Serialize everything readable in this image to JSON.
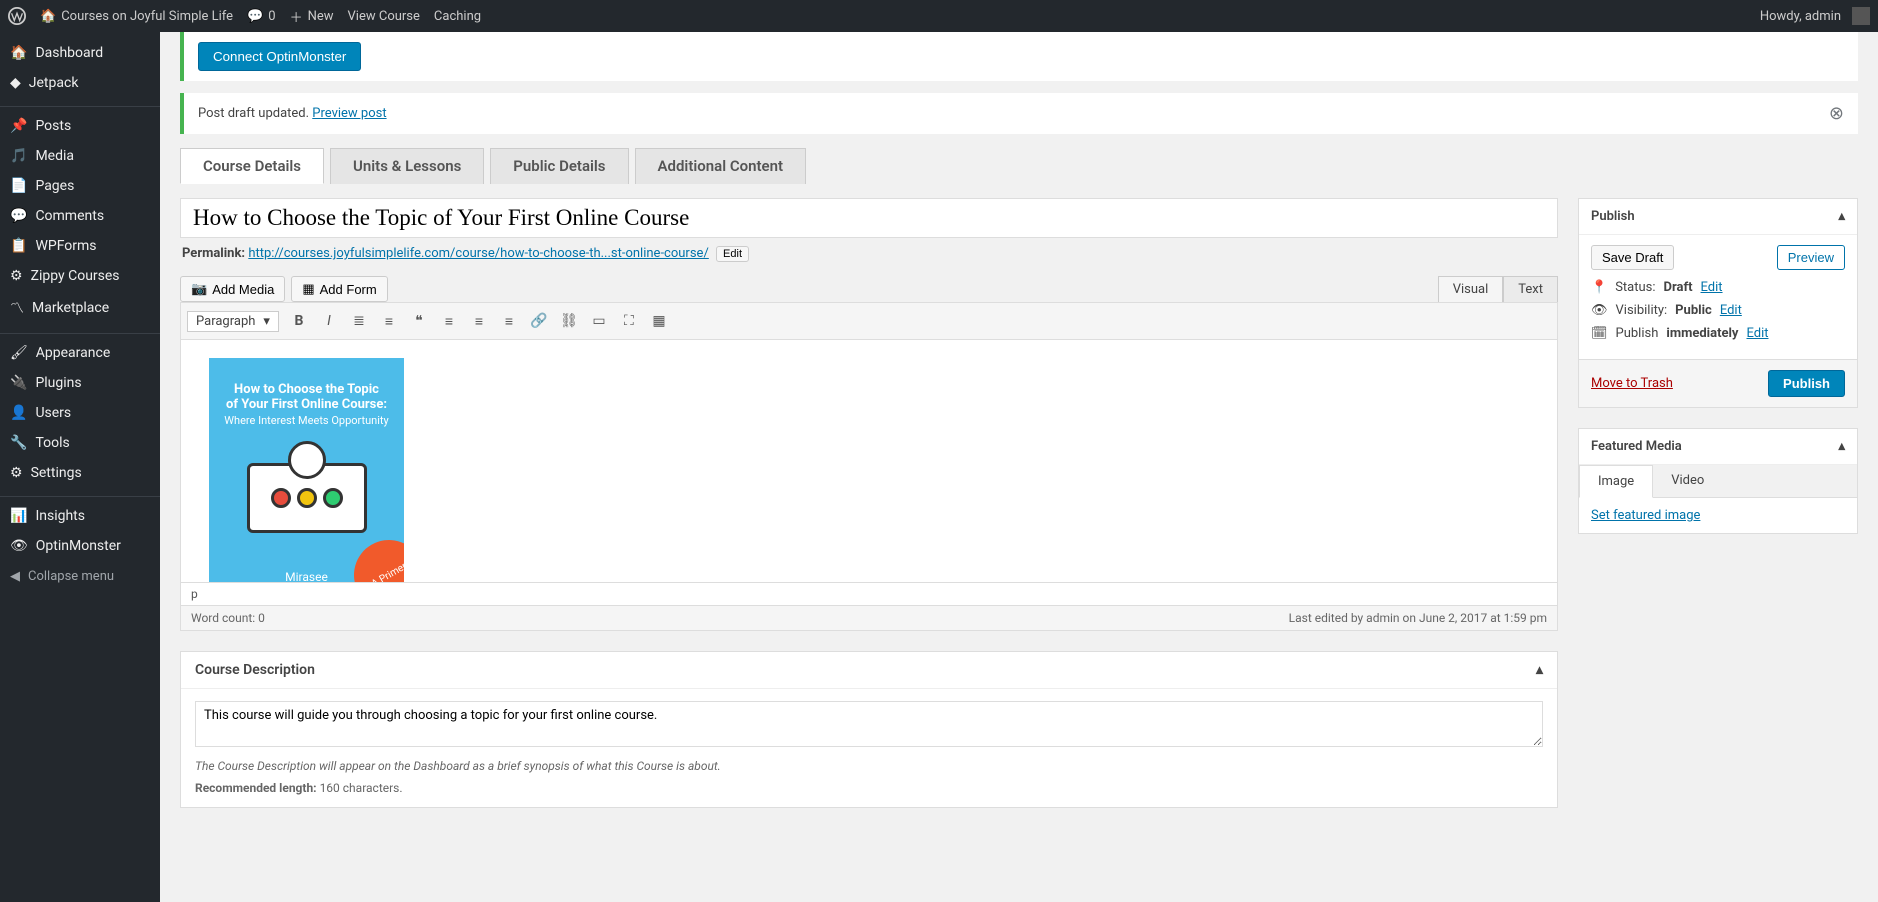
{
  "adminbar": {
    "site_name": "Courses on Joyful Simple Life",
    "comments_count": "0",
    "new_label": "New",
    "view_course": "View Course",
    "caching": "Caching",
    "howdy": "Howdy, admin"
  },
  "sidebar": {
    "items": [
      {
        "label": "Dashboard"
      },
      {
        "label": "Jetpack"
      },
      {
        "label": "Posts"
      },
      {
        "label": "Media"
      },
      {
        "label": "Pages"
      },
      {
        "label": "Comments"
      },
      {
        "label": "WPForms"
      },
      {
        "label": "Zippy Courses"
      },
      {
        "label": "Marketplace"
      },
      {
        "label": "Appearance"
      },
      {
        "label": "Plugins"
      },
      {
        "label": "Users"
      },
      {
        "label": "Tools"
      },
      {
        "label": "Settings"
      },
      {
        "label": "Insights"
      },
      {
        "label": "OptinMonster"
      }
    ],
    "collapse": "Collapse menu"
  },
  "banner": {
    "connect": "Connect OptinMonster"
  },
  "notice": {
    "text": "Post draft updated.",
    "link": "Preview post"
  },
  "tabs": [
    "Course Details",
    "Units & Lessons",
    "Public Details",
    "Additional Content"
  ],
  "title": "How to Choose the Topic of Your First Online Course",
  "permalink": {
    "label": "Permalink:",
    "base": "http://courses.joyfulsimplelife.com/course/",
    "slug": "how-to-choose-th...st-online-course/",
    "edit": "Edit"
  },
  "editor": {
    "add_media": "Add Media",
    "add_form": "Add Form",
    "visual": "Visual",
    "text": "Text",
    "paragraph": "Paragraph",
    "path_label": "p",
    "word_count": "Word count: 0",
    "last_edited": "Last edited by admin on June 2, 2017 at 1:59 pm",
    "card": {
      "l1": "How to Choose the Topic",
      "l2": "of Your First Online Course:",
      "l3": "Where Interest Meets Opportunity",
      "brand": "Mirasee",
      "badge": "A Primer"
    }
  },
  "course_desc": {
    "title": "Course Description",
    "value": "This course will guide you through choosing a topic for your first online course.",
    "note": "The Course Description will appear on the Dashboard as a brief synopsis of what this Course is about.",
    "rec_label": "Recommended length:",
    "rec_value": "160 characters."
  },
  "publish": {
    "title": "Publish",
    "save_draft": "Save Draft",
    "preview": "Preview",
    "status_label": "Status:",
    "status_value": "Draft",
    "visibility_label": "Visibility:",
    "visibility_value": "Public",
    "publish_label": "Publish",
    "publish_value": "immediately",
    "edit": "Edit",
    "trash": "Move to Trash",
    "publish_btn": "Publish"
  },
  "featured": {
    "title": "Featured Media",
    "tab_image": "Image",
    "tab_video": "Video",
    "set_link": "Set featured image"
  }
}
